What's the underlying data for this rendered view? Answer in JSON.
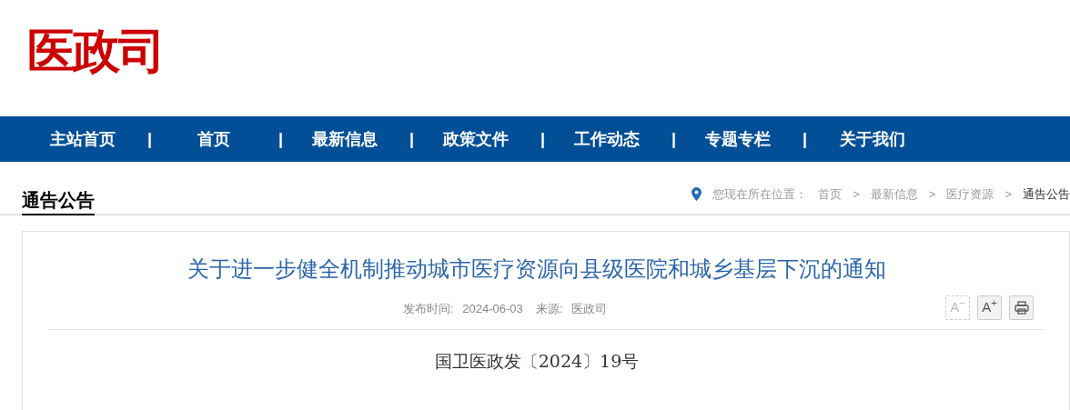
{
  "logo": "医政司",
  "nav": [
    {
      "label": "主站首页",
      "separator": "|"
    },
    {
      "label": "首页",
      "separator": "|"
    },
    {
      "label": "最新信息",
      "separator": "|"
    },
    {
      "label": "政策文件",
      "separator": "|"
    },
    {
      "label": "工作动态",
      "separator": "|"
    },
    {
      "label": "专题专栏",
      "separator": "|"
    },
    {
      "label": "关于我们"
    }
  ],
  "section_title": "通告公告",
  "breadcrumb": {
    "prefix": "您现在所在位置：",
    "items": [
      "首页",
      "最新信息",
      "医疗资源",
      "通告公告"
    ],
    "separator": ">"
  },
  "article": {
    "title": "关于进一步健全机制推动城市医疗资源向县级医院和城乡基层下沉的通知",
    "meta": [
      {
        "label": "发布时间:",
        "value": "2024-06-03"
      },
      {
        "label": "来源:",
        "value": "医政司"
      }
    ],
    "tools": [
      {
        "kind": "font",
        "label": "A$^{−}$",
        "disabled": true
      },
      {
        "kind": "font",
        "label": "A$^{+}$",
        "disabled": false
      },
      {
        "kind": "print"
      }
    ],
    "doc_number": "国卫医政发〔2024〕19号"
  }
}
